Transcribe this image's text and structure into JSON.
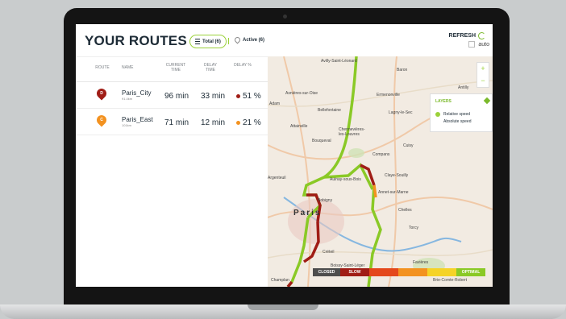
{
  "header": {
    "title": "YOUR ROUTES",
    "total_filter": "Total (6)",
    "active_filter": "Active (6)",
    "refresh_label": "REFRESH",
    "auto_label": "auto"
  },
  "table": {
    "columns": [
      "ROUTE",
      "NAME",
      "CURRENT TIME",
      "DELAY TIME",
      "DELAY %"
    ],
    "rows": [
      {
        "marker": "D",
        "marker_color": "#a01d16",
        "name": "Paris_City",
        "distance": "91.4km",
        "current_time": "96 min",
        "delay_time": "33 min",
        "delay_pct": "51 %",
        "status_color": "#a01d16"
      },
      {
        "marker": "C",
        "marker_color": "#f39220",
        "name": "Paris_East",
        "distance": "101km",
        "current_time": "71 min",
        "delay_time": "12 min",
        "delay_pct": "21 %",
        "status_color": "#f39220"
      }
    ]
  },
  "map": {
    "zoom_in": "+",
    "zoom_out": "−",
    "layers": {
      "title": "LAYERS",
      "options": [
        "Relative speed",
        "Absolute speed"
      ]
    },
    "legend": [
      "CLOSED",
      "SLOW",
      "",
      "",
      "",
      "OPTIMAL"
    ],
    "labels": [
      "Paris",
      "Avilly-Saint-Léonard",
      "Baron",
      "Asnières-sur-Oise",
      "Ermenonville",
      "Antilly",
      "Adam",
      "Bellefontaine",
      "Lagny-le-Sec",
      "Attainville",
      "Chennevières-les-Louvres",
      "Bouqueval",
      "Compans",
      "Cuisy",
      "Argenteuil",
      "Aulnay-sous-Bois",
      "Claye-Souilly",
      "Bobigny",
      "Annet-sur-Marne",
      "Chelles",
      "Créteil",
      "Torcy",
      "Boissy-Saint-Léger",
      "Favières",
      "Champlan",
      "Brie-Comte-Robert"
    ]
  },
  "colors": {
    "accent": "#9bd13a",
    "closed": "#4d4d4d",
    "slow": "#a01d16",
    "orange": "#f39220",
    "yellow": "#f5d327",
    "optimal": "#8ac926"
  }
}
